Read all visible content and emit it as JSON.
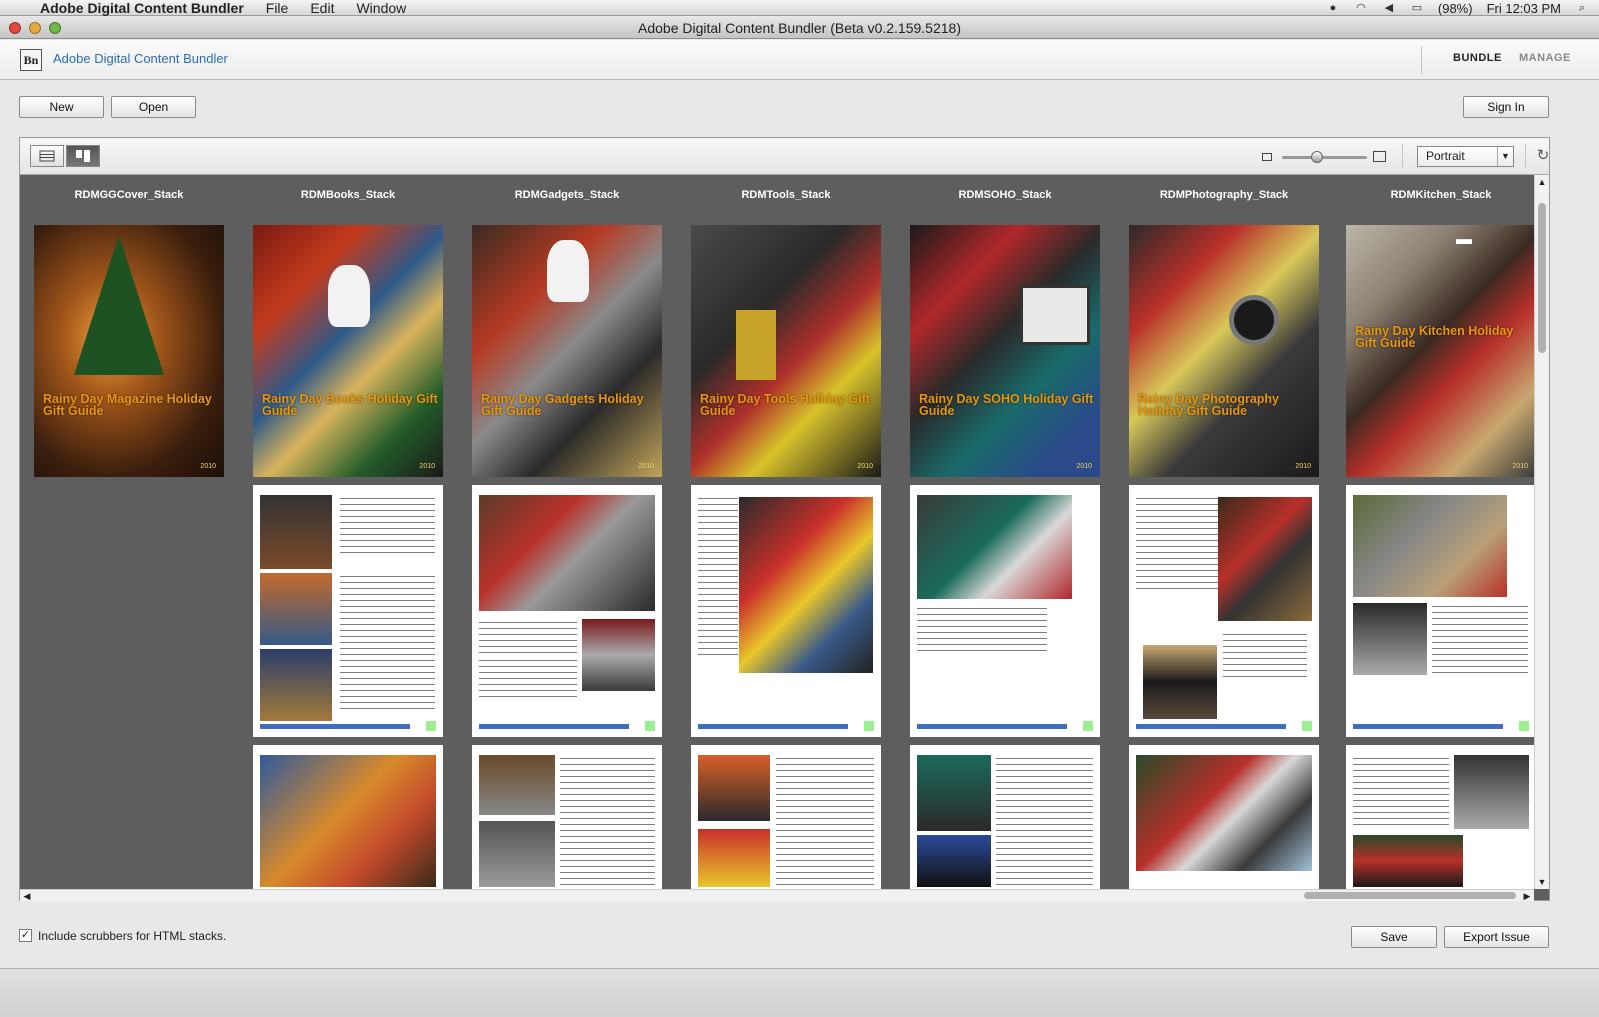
{
  "menubar": {
    "app_name": "Adobe Digital Content Bundler",
    "menus": [
      "File",
      "Edit",
      "Window"
    ],
    "battery": "(98%)",
    "clock": "Fri 12:03 PM"
  },
  "window": {
    "title": "Adobe Digital Content Bundler (Beta v0.2.159.5218)"
  },
  "header": {
    "logo_text": "Bn",
    "app_title": "Adobe Digital Content Bundler",
    "nav": {
      "bundle": "BUNDLE",
      "manage": "MANAGE"
    }
  },
  "actions": {
    "new": "New",
    "open": "Open",
    "sign_in": "Sign In"
  },
  "toolbar": {
    "orientation": "Portrait",
    "zoom_level": 0.4
  },
  "stacks": [
    {
      "name": "RDMGGCover_Stack",
      "cover_title": "Rainy Day Magazine Holiday Gift Guide",
      "year": "2010",
      "pages": 1
    },
    {
      "name": "RDMBooks_Stack",
      "cover_title": "Rainy Day Books Holiday Gift Guide",
      "year": "2010",
      "pages": 3
    },
    {
      "name": "RDMGadgets_Stack",
      "cover_title": "Rainy Day Gadgets Holiday Gift Guide",
      "year": "2010",
      "pages": 3
    },
    {
      "name": "RDMTools_Stack",
      "cover_title": "Rainy Day Tools Holiday Gift Guide",
      "year": "2010",
      "pages": 3
    },
    {
      "name": "RDMSOHO_Stack",
      "cover_title": "Rainy Day SOHO Holiday Gift Guide",
      "year": "2010",
      "pages": 3
    },
    {
      "name": "RDMPhotography_Stack",
      "cover_title": "Rainy Day Photography Holiday Gift Guide",
      "year": "2010",
      "pages": 3
    },
    {
      "name": "RDMKitchen_Stack",
      "cover_title": "Rainy Day Kitchen Holiday Gift Guide",
      "year": "2010",
      "pages": 3
    }
  ],
  "footer": {
    "scrubbers_label": "Include scrubbers for HTML stacks.",
    "scrubbers_checked": true,
    "save": "Save",
    "export": "Export Issue"
  },
  "colors": {
    "link_blue": "#2a6db6",
    "cover_title_orange": "#e8960e",
    "grid_bg": "#5e5e5e"
  }
}
